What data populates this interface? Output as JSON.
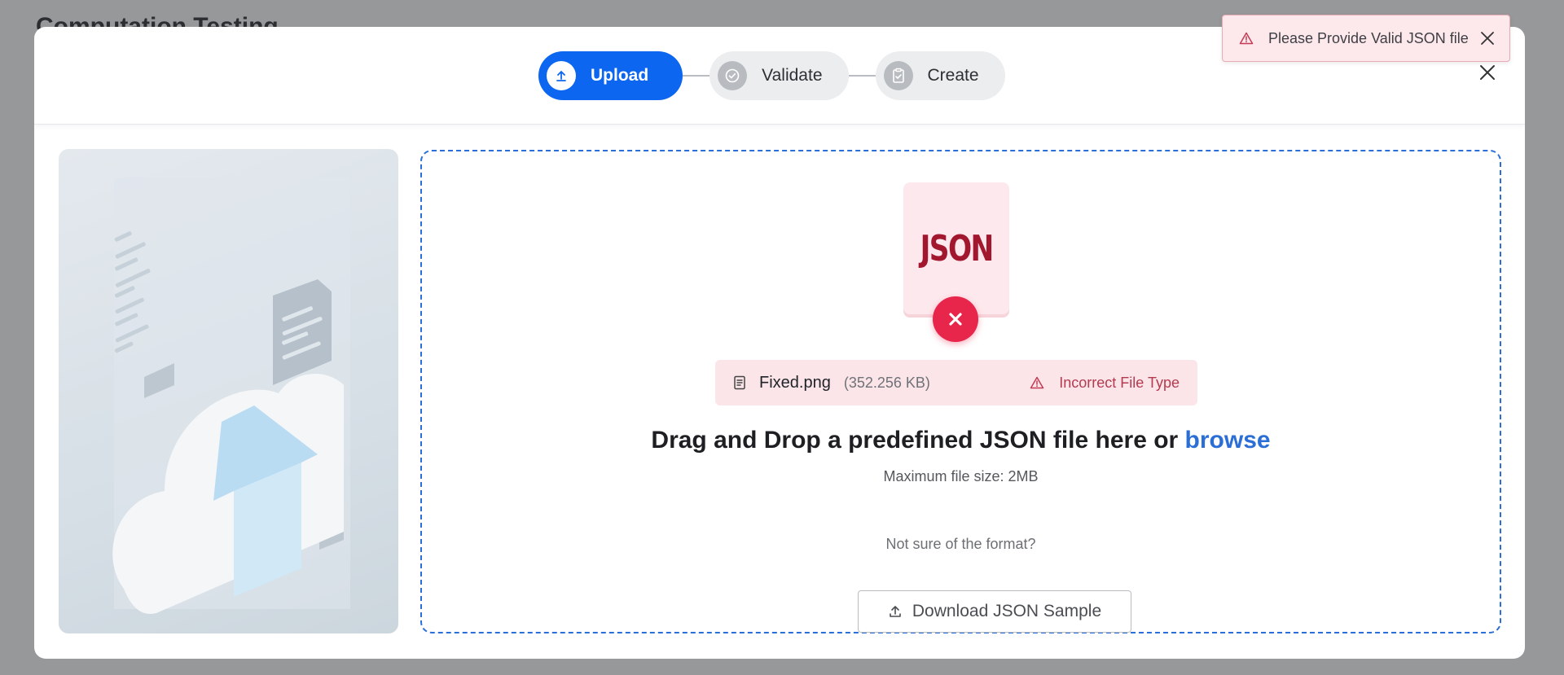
{
  "background": {
    "page_title": "Computation Testing"
  },
  "stepper": {
    "steps": [
      {
        "label": "Upload",
        "icon": "upload-icon",
        "state": "active"
      },
      {
        "label": "Validate",
        "icon": "check-circle-icon",
        "state": "inactive"
      },
      {
        "label": "Create",
        "icon": "clipboard-check-icon",
        "state": "inactive"
      }
    ]
  },
  "dropzone": {
    "file_icon_text": "JSON",
    "file": {
      "name": "Fixed.png",
      "size": "(352.256 KB)",
      "error": "Incorrect File Type"
    },
    "heading_prefix": "Drag and Drop a predefined JSON file here or ",
    "browse_link": "browse",
    "max_size": "Maximum file size: 2MB",
    "not_sure": "Not sure of the format?",
    "download_label": "Download JSON Sample"
  },
  "toast": {
    "message": "Please Provide Valid JSON file",
    "icon": "warning-triangle-icon"
  },
  "colors": {
    "primary": "#0d66f0",
    "link": "#2b6fd6",
    "error": "#e8254a",
    "error_bg": "#fbe5e9",
    "overlay": "#97989a"
  }
}
